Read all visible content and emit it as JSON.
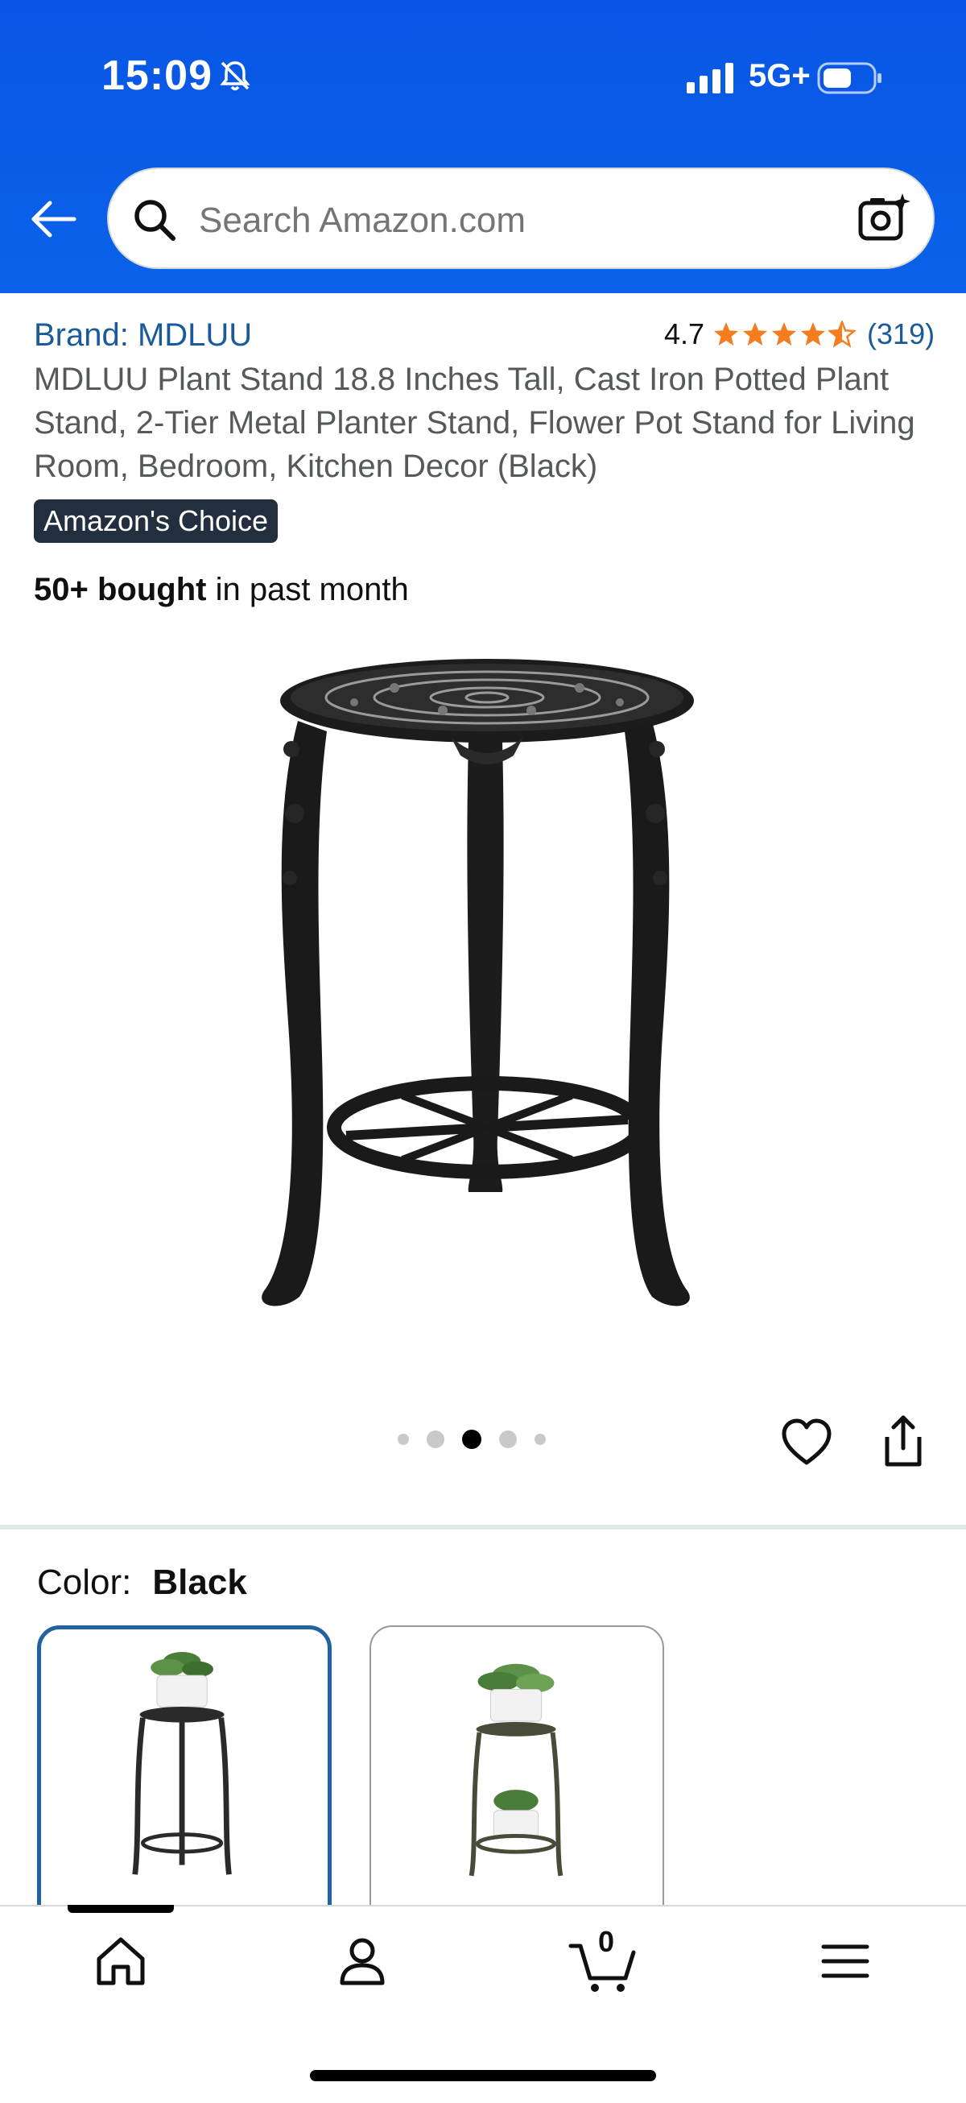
{
  "status_bar": {
    "time": "15:09",
    "network": "5G+"
  },
  "search": {
    "placeholder": "Search Amazon.com"
  },
  "product": {
    "brand": "Brand: MDLUU",
    "rating_value": "4.7",
    "rating_stars": 4.7,
    "rating_count": "(319)",
    "title": "MDLUU Plant Stand 18.8 Inches Tall, Cast Iron Potted Plant Stand, 2-Tier Metal Planter Stand, Flower Pot Stand for Living Room, Bedroom, Kitchen Decor (Black)",
    "badge": "Amazon's Choice",
    "bought_bold": "50+ bought",
    "bought_rest": " in past month",
    "image_count": 5,
    "active_image": 3
  },
  "color": {
    "label": "Color:",
    "selected": "Black"
  },
  "bottom_nav": {
    "items": [
      "home-icon",
      "account-icon",
      "cart-icon",
      "menu-icon"
    ],
    "cart_count": "0"
  },
  "colors": {
    "header_blue": "#0a55e6",
    "link_blue": "#1a5a9a",
    "star_orange": "#f57c1f",
    "badge_dark": "#232f3e"
  }
}
